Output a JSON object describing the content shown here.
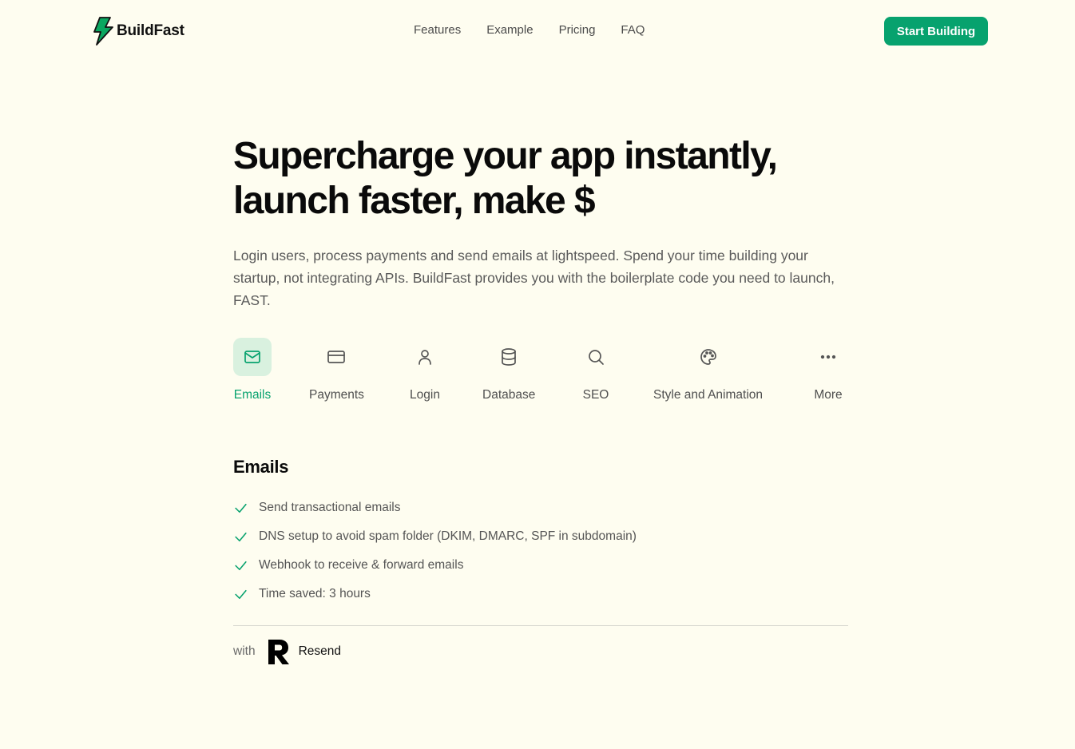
{
  "header": {
    "brand": "BuildFast",
    "logo_icon": "lightning-bolt-icon",
    "nav": [
      {
        "label": "Features"
      },
      {
        "label": "Example"
      },
      {
        "label": "Pricing"
      },
      {
        "label": "FAQ"
      }
    ],
    "cta_label": "Start Building"
  },
  "hero": {
    "title_line1": "Supercharge your app instantly,",
    "title_line2": "launch faster, make $",
    "description": "Login users, process payments and send emails at lightspeed. Spend your time building your startup, not integrating APIs. BuildFast provides you with the boilerplate code you need to launch, FAST."
  },
  "tabs": [
    {
      "label": "Emails",
      "icon": "mail-icon",
      "active": true
    },
    {
      "label": "Payments",
      "icon": "credit-card-icon",
      "active": false
    },
    {
      "label": "Login",
      "icon": "user-icon",
      "active": false
    },
    {
      "label": "Database",
      "icon": "database-icon",
      "active": false
    },
    {
      "label": "SEO",
      "icon": "search-icon",
      "active": false
    },
    {
      "label": "Style and Animation",
      "icon": "palette-icon",
      "active": false
    },
    {
      "label": "More",
      "icon": "more-horizontal-icon",
      "active": false
    }
  ],
  "panel": {
    "title": "Emails",
    "features": [
      "Send transactional emails",
      "DNS setup to avoid spam folder (DKIM, DMARC, SPF in subdomain)",
      "Webhook to receive & forward emails",
      "Time saved: 3 hours"
    ],
    "with_label": "with",
    "provider_name": "Resend",
    "provider_icon": "resend-logo-icon"
  },
  "colors": {
    "background": "#fefdf0",
    "accent": "#07a26e",
    "active_tab_bg": "#d9f1df",
    "text": "#0a0a0a"
  }
}
